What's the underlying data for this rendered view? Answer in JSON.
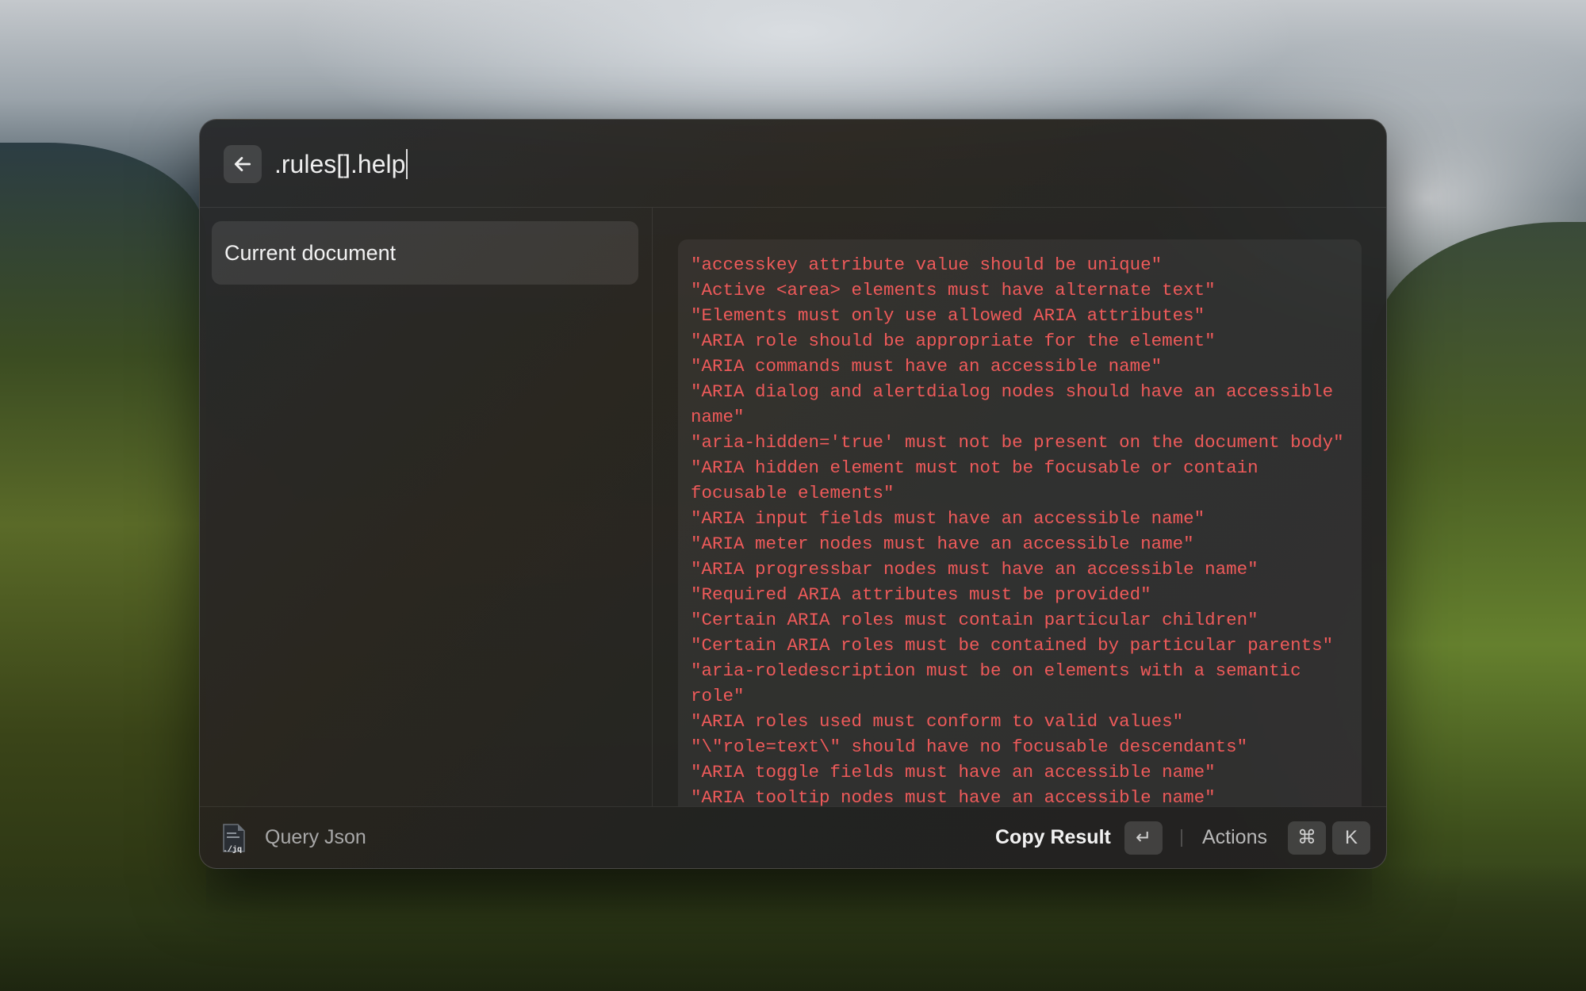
{
  "header": {
    "query_value": ".rules[].help"
  },
  "sidebar": {
    "items": [
      {
        "label": "Current document"
      }
    ]
  },
  "result": {
    "lines": [
      "\"accesskey attribute value should be unique\"",
      "\"Active <area> elements must have alternate text\"",
      "\"Elements must only use allowed ARIA attributes\"",
      "\"ARIA role should be appropriate for the element\"",
      "\"ARIA commands must have an accessible name\"",
      "\"ARIA dialog and alertdialog nodes should have an accessible name\"",
      "\"aria-hidden='true' must not be present on the document body\"",
      "\"ARIA hidden element must not be focusable or contain focusable elements\"",
      "\"ARIA input fields must have an accessible name\"",
      "\"ARIA meter nodes must have an accessible name\"",
      "\"ARIA progressbar nodes must have an accessible name\"",
      "\"Required ARIA attributes must be provided\"",
      "\"Certain ARIA roles must contain particular children\"",
      "\"Certain ARIA roles must be contained by particular parents\"",
      "\"aria-roledescription must be on elements with a semantic role\"",
      "\"ARIA roles used must conform to valid values\"",
      "\"\\\"role=text\\\" should have no focusable descendants\"",
      "\"ARIA toggle fields must have an accessible name\"",
      "\"ARIA tooltip nodes must have an accessible name\""
    ],
    "text_color": "#ee5a5a"
  },
  "footer": {
    "app_icon_label": "./jq",
    "app_name": "Query Json",
    "primary_action": "Copy Result",
    "primary_key": "↵",
    "actions_label": "Actions",
    "actions_keys": [
      "⌘",
      "K"
    ]
  },
  "icons": {
    "back": "arrow-left-icon",
    "app": "jq-file-icon"
  }
}
